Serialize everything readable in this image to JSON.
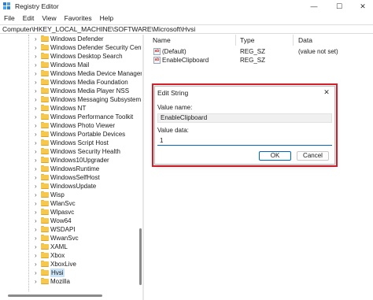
{
  "window": {
    "title": "Registry Editor",
    "minimize_glyph": "—",
    "maximize_glyph": "☐",
    "close_glyph": "✕",
    "icon": "registry-editor-icon"
  },
  "menu": [
    "File",
    "Edit",
    "View",
    "Favorites",
    "Help"
  ],
  "address": "Computer\\HKEY_LOCAL_MACHINE\\SOFTWARE\\Microsoft\\Hvsi",
  "tree": {
    "items": [
      {
        "label": "Windows Defender",
        "selected": false
      },
      {
        "label": "Windows Defender Security Center",
        "selected": false
      },
      {
        "label": "Windows Desktop Search",
        "selected": false
      },
      {
        "label": "Windows Mail",
        "selected": false
      },
      {
        "label": "Windows Media Device Manager",
        "selected": false
      },
      {
        "label": "Windows Media Foundation",
        "selected": false
      },
      {
        "label": "Windows Media Player NSS",
        "selected": false
      },
      {
        "label": "Windows Messaging Subsystem",
        "selected": false
      },
      {
        "label": "Windows NT",
        "selected": false
      },
      {
        "label": "Windows Performance Toolkit",
        "selected": false
      },
      {
        "label": "Windows Photo Viewer",
        "selected": false
      },
      {
        "label": "Windows Portable Devices",
        "selected": false
      },
      {
        "label": "Windows Script Host",
        "selected": false
      },
      {
        "label": "Windows Security Health",
        "selected": false
      },
      {
        "label": "Windows10Upgrader",
        "selected": false
      },
      {
        "label": "WindowsRuntime",
        "selected": false
      },
      {
        "label": "WindowsSelfHost",
        "selected": false
      },
      {
        "label": "WindowsUpdate",
        "selected": false
      },
      {
        "label": "Wisp",
        "selected": false
      },
      {
        "label": "WlanSvc",
        "selected": false
      },
      {
        "label": "Wlpasvc",
        "selected": false
      },
      {
        "label": "Wow64",
        "selected": false
      },
      {
        "label": "WSDAPI",
        "selected": false
      },
      {
        "label": "WwanSvc",
        "selected": false
      },
      {
        "label": "XAML",
        "selected": false
      },
      {
        "label": "Xbox",
        "selected": false
      },
      {
        "label": "XboxLive",
        "selected": false
      },
      {
        "label": "Hvsi",
        "selected": true
      },
      {
        "label": "Mozilla",
        "selected": false
      }
    ],
    "expander_glyph": "›"
  },
  "list": {
    "headers": {
      "name": "Name",
      "type": "Type",
      "data": "Data"
    },
    "rows": [
      {
        "name": "(Default)",
        "type": "REG_SZ",
        "data": "(value not set)",
        "icon": "string-value-icon",
        "icon_text": "ab"
      },
      {
        "name": "EnableClipboard",
        "type": "REG_SZ",
        "data": "",
        "icon": "string-value-icon",
        "icon_text": "ab"
      }
    ]
  },
  "dialog": {
    "title": "Edit String",
    "close_glyph": "✕",
    "value_name_label": "Value name:",
    "value_name": "EnableClipboard",
    "value_data_label": "Value data:",
    "value_data": "1",
    "ok_label": "OK",
    "cancel_label": "Cancel",
    "highlight_color": "#d9202a"
  }
}
